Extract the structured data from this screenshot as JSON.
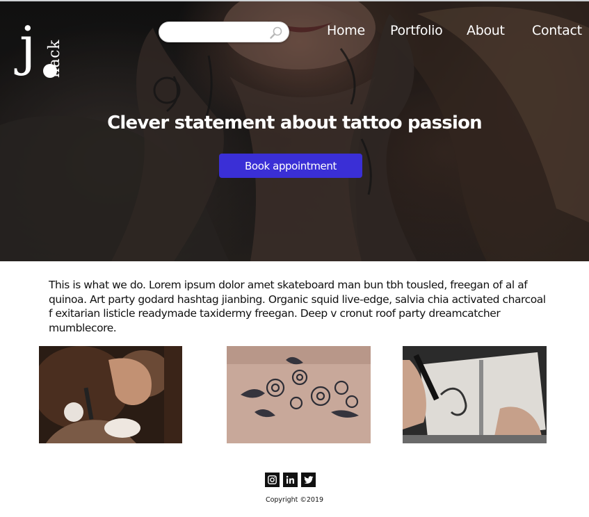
{
  "brand": {
    "logo_letter": "j",
    "logo_word": "hack"
  },
  "search": {
    "placeholder": "",
    "value": ""
  },
  "nav": {
    "items": [
      "Home",
      "Portfolio",
      "About",
      "Contact"
    ]
  },
  "hero": {
    "headline": "Clever statement about tattoo passion",
    "cta_label": "Book appointment",
    "cta_color": "#3a2fd6"
  },
  "intro": {
    "text": "This is what we do.  Lorem ipsum dolor amet skateboard man bun tbh tousled, freegan of al af quinoa. Art party godard hashtag jianbing. Organic squid live-edge, salvia chia activated charcoal f exitarian listicle readymade taxidermy freegan. Deep v cronut roof party dreamcatcher mumblecore."
  },
  "gallery": {
    "images": [
      "tattoo-artist-working",
      "floral-forearm-tattoo",
      "sketchbook-drawing"
    ]
  },
  "social": {
    "icons": [
      "instagram-icon",
      "linkedin-icon",
      "twitter-icon"
    ]
  },
  "footer": {
    "copyright": "Copyright ©2019"
  }
}
